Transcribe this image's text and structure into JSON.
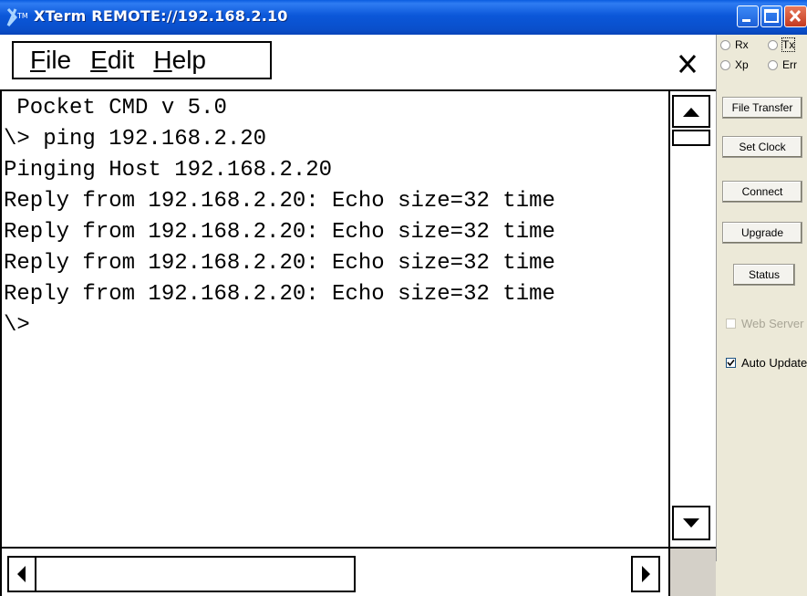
{
  "window": {
    "title": "XTerm REMOTE://192.168.2.10",
    "app_icon": "x-logo-icon",
    "controls": [
      "minimize-icon",
      "maximize-icon",
      "close-icon"
    ]
  },
  "menu": {
    "items": [
      "File",
      "Edit",
      "Help"
    ],
    "close_glyph": "✕"
  },
  "terminal": {
    "lines": [
      " Pocket CMD v 5.0",
      "\\> ping 192.168.2.20",
      "Pinging Host 192.168.2.20",
      "Reply from 192.168.2.20: Echo size=32 time",
      "Reply from 192.168.2.20: Echo size=32 time",
      "Reply from 192.168.2.20: Echo size=32 time",
      "Reply from 192.168.2.20: Echo size=32 time",
      "\\>"
    ]
  },
  "side": {
    "radios": [
      {
        "label": "Rx",
        "selected": false
      },
      {
        "label": "Tx",
        "selected": false
      },
      {
        "label": "Xp",
        "selected": false
      },
      {
        "label": "Err",
        "selected": false
      }
    ],
    "buttons": {
      "file_transfer": "File Transfer",
      "set_clock": "Set Clock",
      "connect": "Connect",
      "upgrade": "Upgrade",
      "status": "Status"
    },
    "checkboxes": {
      "web_server": {
        "label": "Web Server",
        "checked": false,
        "enabled": false
      },
      "auto_update": {
        "label": "Auto Update",
        "checked": true,
        "enabled": true
      }
    }
  }
}
